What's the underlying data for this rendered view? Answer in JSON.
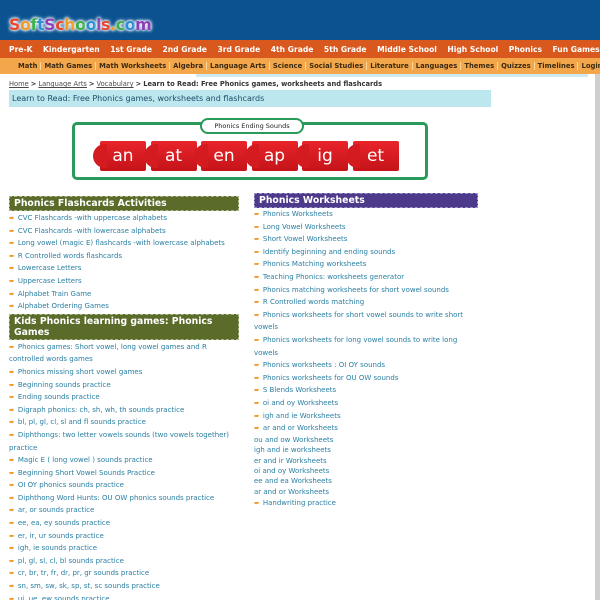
{
  "site": {
    "logo_letters": [
      {
        "ch": "S",
        "color": "#e8462a"
      },
      {
        "ch": "o",
        "color": "#f29a1f"
      },
      {
        "ch": "f",
        "color": "#3bb04a"
      },
      {
        "ch": "t",
        "color": "#2a8fd6"
      },
      {
        "ch": "S",
        "color": "#8e3fb8"
      },
      {
        "ch": "c",
        "color": "#e8462a"
      },
      {
        "ch": "h",
        "color": "#f29a1f"
      },
      {
        "ch": "o",
        "color": "#3bb04a"
      },
      {
        "ch": "o",
        "color": "#2a8fd6"
      },
      {
        "ch": "l",
        "color": "#8e3fb8"
      },
      {
        "ch": "s",
        "color": "#e8462a"
      },
      {
        "ch": ".",
        "color": "#f29a1f"
      },
      {
        "ch": "c",
        "color": "#3bb04a"
      },
      {
        "ch": "o",
        "color": "#2a8fd6"
      },
      {
        "ch": "m",
        "color": "#8e3fb8"
      }
    ],
    "logo_text": "SoftSchools.com"
  },
  "nav_primary": [
    "Pre-K",
    "Kindergarten",
    "1st Grade",
    "2nd Grade",
    "3rd Grade",
    "4th Grade",
    "5th Grade",
    "Middle School",
    "High School",
    "Phonics",
    "Fun Games"
  ],
  "nav_secondary": [
    "Math",
    "Math Games",
    "Math Worksheets",
    "Algebra",
    "Language Arts",
    "Science",
    "Social Studies",
    "Literature",
    "Languages",
    "Themes",
    "Quizzes",
    "Timelines",
    "Login"
  ],
  "breadcrumb": {
    "links": [
      "Home",
      "Language Arts",
      "Vocabulary"
    ],
    "separator": ">",
    "current": "Learn to Read: Free Phonics games, worksheets and flashcards"
  },
  "page_title": "Learn to Read: Free Phonics games, worksheets and flashcards",
  "banner": {
    "label": "Phonics Ending Sounds",
    "tiles": [
      "an",
      "at",
      "en",
      "ap",
      "ig",
      "et"
    ]
  },
  "flashcards": {
    "heading": "Phonics Flashcards Activities",
    "items": [
      "CVC Flashcards -with uppercase alphabets",
      "CVC Flashcards -with lowercase alphabets",
      "Long vowel (magic E) flashcards -with lowercase alphabets",
      "R Controlled words flashcards",
      "Lowercase Letters",
      "Uppercase Letters",
      "Alphabet Train Game",
      "Alphabet Ordering Games"
    ]
  },
  "games": {
    "heading": "Kids Phonics learning games: Phonics Games",
    "items": [
      "Phonics games: Short vowel, long vowel games and R controlled words games",
      "Phonics missing short vowel games",
      "Beginning sounds practice",
      "Ending sounds practice",
      "Digraph phonics: ch, sh, wh, th sounds practice",
      "bl, pl, gl, cl, sl and fl sounds practice",
      "Diphthongs: two letter vowels sounds (two vowels together) practice",
      "Magic E ( long vowel ) sounds practice",
      "Beginning Short Vowel Sounds Practice",
      "OI OY phonics sounds practice",
      "Diphthong Word Hunts: OU OW phonics sounds practice",
      "ar, or sounds practice",
      "ee, ea, ey sounds practice",
      "er, ir, ur sounds practice",
      "igh, ie sounds practice",
      "pl, gl, sl, cl, bl sounds practice",
      "cr, br, tr, fr, dr, pr, gr sounds practice",
      "sn, sm, sw, sk, sp, st, sc sounds practice",
      "ui, ue, ew sounds practice"
    ]
  },
  "worksheets": {
    "heading": "Phonics Worksheets",
    "items": [
      {
        "text": "Phonics Worksheets",
        "arrow": true
      },
      {
        "text": "Long Vowel Worksheets",
        "arrow": true
      },
      {
        "text": "Short Vowel Worksheets",
        "arrow": true
      },
      {
        "text": "Identify beginning and ending sounds",
        "arrow": true
      },
      {
        "text": "Phonics Matching worksheets",
        "arrow": true
      },
      {
        "text": "Teaching Phonics: worksheets generator",
        "arrow": true
      },
      {
        "text": "Phonics matching worksheets for short vowel sounds",
        "arrow": true
      },
      {
        "text": "R Controlled words matching",
        "arrow": true
      },
      {
        "text": "Phonics worksheets for short vowel sounds to write short vowels",
        "arrow": true
      },
      {
        "text": "Phonics worksheets for long vowel sounds to write long vowels",
        "arrow": true
      },
      {
        "text": "Phonics worksheets : OI OY sounds",
        "arrow": true
      },
      {
        "text": "Phonics worksheets for OU OW sounds",
        "arrow": true
      },
      {
        "text": "S Blends Worksheets",
        "arrow": true
      },
      {
        "text": "oi and oy Worksheets",
        "arrow": true
      },
      {
        "text": "igh and ie Worksheets",
        "arrow": true
      },
      {
        "text": "ar and or Worksheets",
        "arrow": true
      },
      {
        "text": "ou and ow Worksheets",
        "arrow": false
      },
      {
        "text": "igh and ie worksheets",
        "arrow": false
      },
      {
        "text": "er and ir Worksheets",
        "arrow": false
      },
      {
        "text": "oi and oy Worksheets",
        "arrow": false
      },
      {
        "text": "ee and ea Worksheets",
        "arrow": false
      },
      {
        "text": "ar and or Worksheets",
        "arrow": false
      },
      {
        "text": "Handwriting practice",
        "arrow": true
      }
    ]
  },
  "icons": {
    "bullet": "arrow-right-icon",
    "bullet_glyph": "➨"
  },
  "colors": {
    "header_bg": "#0a5390",
    "nav_primary_bg": "#d9581d",
    "nav_secondary_bg": "#f4a74a",
    "title_bar_bg": "#bde7ef",
    "section_green": "#5a6b2a",
    "section_purple": "#4d3a8a",
    "link": "#2a7fa3",
    "bullet": "#f19a2c",
    "banner_border": "#2a9a5a",
    "tile_red": "#d41b20"
  }
}
